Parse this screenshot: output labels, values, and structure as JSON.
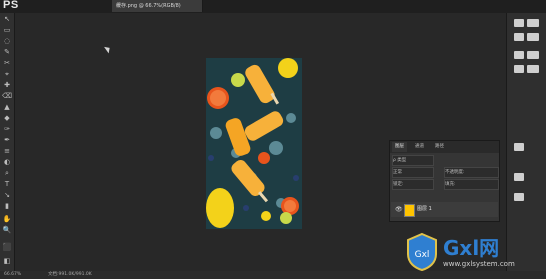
{
  "app": {
    "logo": "PS"
  },
  "document": {
    "tab_title": "缓存.png @ 66.7%(RGB/8)",
    "close": "×"
  },
  "tools": [
    "↖",
    "▭",
    "◌",
    "✎",
    "✂",
    "⌖",
    "✚",
    "⌫",
    "▲",
    "◆",
    "✑",
    "✒",
    "≡",
    "◐",
    "⌕",
    "T",
    "↘",
    "▮",
    "✋",
    "🔍",
    "⬛",
    "◧"
  ],
  "layers_panel": {
    "tabs": [
      "图层",
      "通道",
      "路径"
    ],
    "filter_label": "ρ 类型",
    "blend_mode": "正常",
    "opacity_label": "不透明度:",
    "lock_label": "锁定:",
    "fill_label": "填充:",
    "layer_name": "图层 1",
    "eye_icon": "👁"
  },
  "status": {
    "zoom": "66.67%",
    "doc_size": "文档:991.0K/991.0K"
  },
  "watermark": {
    "brand": "Gxl网",
    "url": "www.gxlsystem.com",
    "logo_text": "Gxl"
  },
  "colors": {
    "photo_bg": "#1e3d44",
    "popsicle": "#f7b13a",
    "orange": "#e8541c",
    "lemon": "#f3d21a"
  }
}
